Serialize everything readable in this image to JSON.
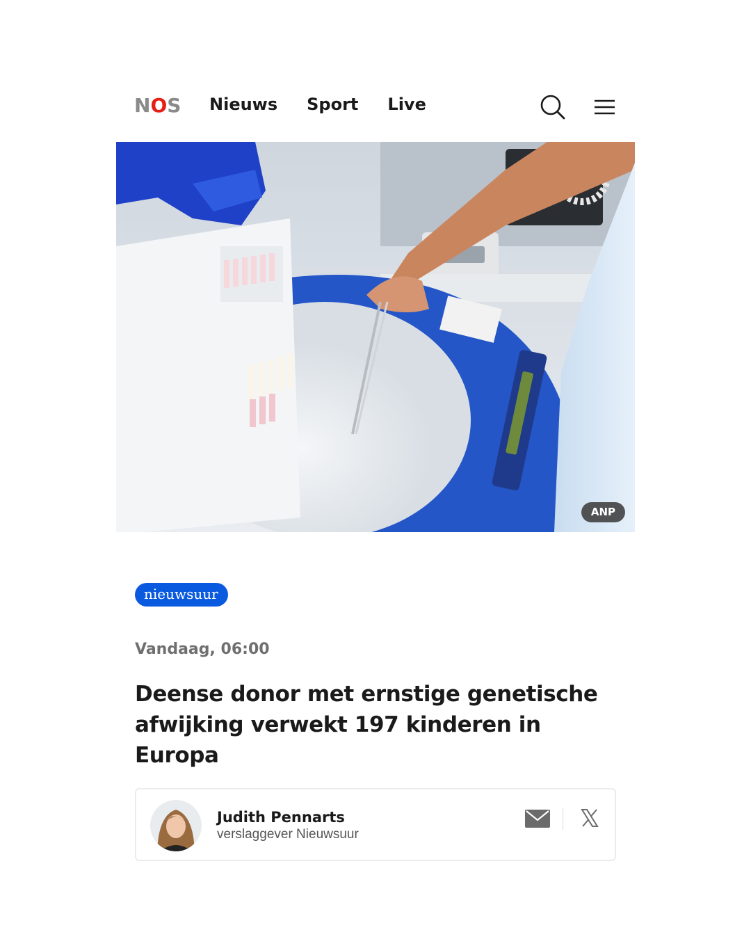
{
  "header": {
    "logo": {
      "n": "N",
      "o": "O",
      "s": "S"
    },
    "nav": [
      "Nieuws",
      "Sport",
      "Live"
    ],
    "icons": {
      "search": "search-icon",
      "menu": "hamburger-menu-icon"
    }
  },
  "hero": {
    "credit": "ANP"
  },
  "article": {
    "program_badge": "nieuwsuur",
    "date": "Vandaag, 06:00",
    "headline": "Deense donor met ernstige genetische afwijking verwekt 197 kinderen in Europa"
  },
  "author": {
    "name": "Judith Pennarts",
    "role": "verslaggever Nieuwsuur",
    "icons": {
      "mail": "mail-icon",
      "x": "x-logo-icon"
    }
  },
  "colors": {
    "logo_red": "#e61e14",
    "logo_grey": "#8a8a8a",
    "badge_blue": "#0a5ae0",
    "date_grey": "#6f6f6f"
  }
}
